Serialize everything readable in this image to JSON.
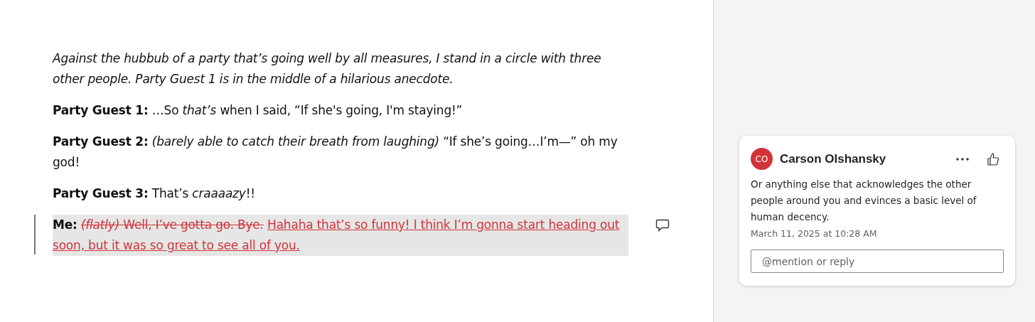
{
  "document": {
    "paragraphs": [
      {
        "kind": "stage",
        "text": "Against the hubbub of a party that’s going well by all measures, I stand in a circle with three other people. Party Guest 1 is in the middle of a hilarious anecdote."
      },
      {
        "kind": "dialogue",
        "speaker": "Party Guest 1:",
        "text": "…So *that’s* when I said, “If she's going, I'm staying!”"
      },
      {
        "kind": "dialogue",
        "speaker": "Party Guest 2:",
        "text": "*(barely able to catch their breath from laughing)* “If she’s going…I’m—” oh my god!"
      },
      {
        "kind": "dialogue",
        "speaker": "Party Guest 3:",
        "text": "That’s *craaaazy*!!"
      },
      {
        "kind": "tracked",
        "speaker": "Me:",
        "deleted": "*(flatly)* Well, I’ve gotta go. Bye.",
        "inserted": "Hahaha that’s so funny! I think I’m gonna start heading out soon, but it was so great to see all of you.",
        "selected": true,
        "has_comment": true
      }
    ]
  },
  "comment": {
    "initials": "CO",
    "color": "#d13438",
    "author": "Carson Olshansky",
    "body": "Or anything else that acknowledges the other people around you and evinces a basic level of human decency.",
    "time": "March 11, 2025 at 10:28 AM",
    "reply": {
      "placeholder": "@mention or reply"
    }
  }
}
